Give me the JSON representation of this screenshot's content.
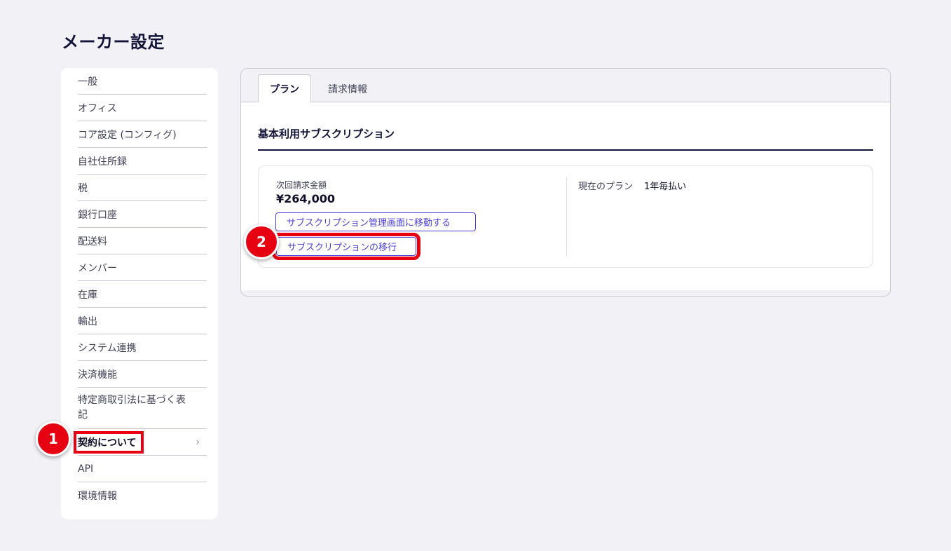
{
  "page": {
    "title": "メーカー設定"
  },
  "sidebar": {
    "items": [
      {
        "label": "一般"
      },
      {
        "label": "オフィス"
      },
      {
        "label": "コア設定 (コンフィグ)"
      },
      {
        "label": "自社住所録"
      },
      {
        "label": "税"
      },
      {
        "label": "銀行口座"
      },
      {
        "label": "配送料"
      },
      {
        "label": "メンバー"
      },
      {
        "label": "在庫"
      },
      {
        "label": "輸出"
      },
      {
        "label": "システム連携"
      },
      {
        "label": "決済機能"
      },
      {
        "label": "特定商取引法に基づく表記"
      },
      {
        "label": "契約について",
        "active": true,
        "chevron": "›"
      },
      {
        "label": "API"
      },
      {
        "label": "環境情報"
      }
    ]
  },
  "tabs": [
    {
      "label": "プラン",
      "active": true
    },
    {
      "label": "請求情報",
      "active": false
    }
  ],
  "section": {
    "title": "基本利用サブスクリプション"
  },
  "billing": {
    "next_label": "次回請求金額",
    "next_amount": "¥264,000",
    "manage_button": "サブスクリプション管理画面に移動する",
    "migrate_button": "サブスクリプションの移行"
  },
  "plan": {
    "label": "現在のプラン",
    "value": "1年毎払い"
  },
  "callouts": {
    "one": "1",
    "two": "2"
  },
  "colors": {
    "accent": "#4b3fd8",
    "highlight": "#e60012",
    "background": "#f2f2f6"
  }
}
